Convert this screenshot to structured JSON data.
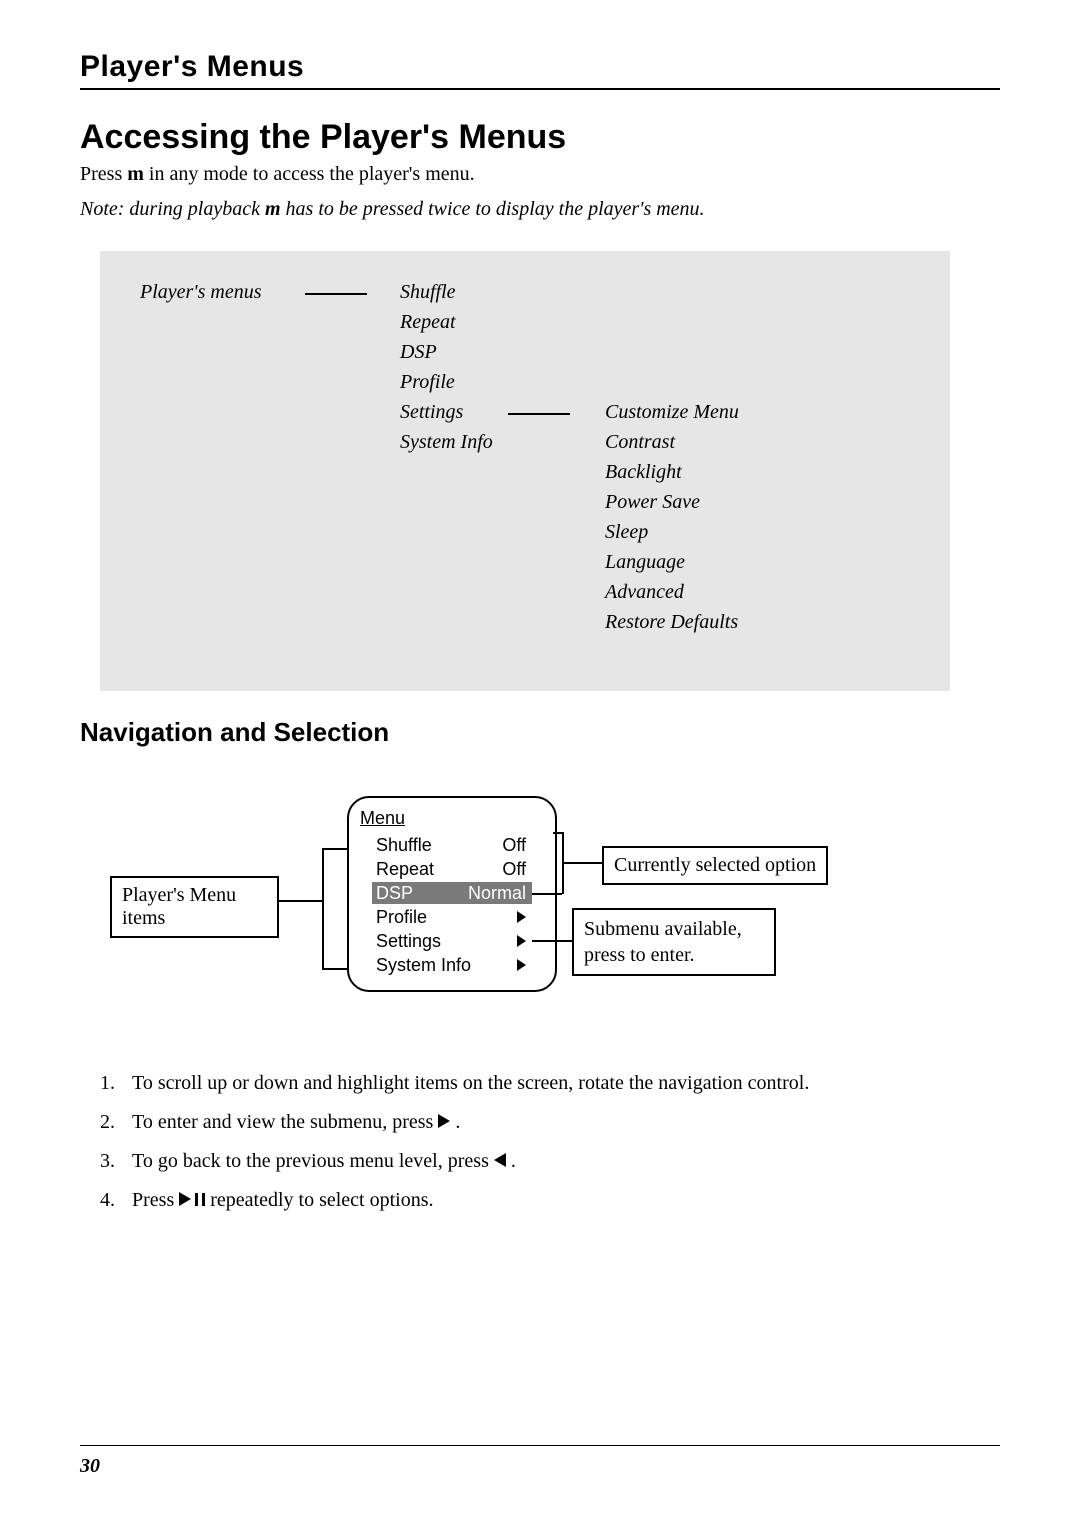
{
  "header": {
    "title": "Player's Menus"
  },
  "sectionTitle": "Accessing the Player's Menus",
  "intro": {
    "pre": "Press ",
    "key": "m",
    "post": " in any mode to access the player's menu."
  },
  "note": {
    "pre": "Note: during playback ",
    "key": "m",
    "post": " has to be pressed twice to display the player's menu."
  },
  "menuDiagram": {
    "rootLabel": "Player's menus",
    "topMenu": [
      "Shuffle",
      "Repeat",
      "DSP",
      "Profile",
      "Settings",
      "System Info"
    ],
    "settingsSubmenu": [
      "Customize Menu",
      "Contrast",
      "Backlight",
      "Power Save",
      "Sleep",
      "Language",
      "Advanced",
      "Restore Defaults"
    ]
  },
  "navSection": {
    "heading": "Navigation and Selection",
    "labelLeft": "Player's Menu items",
    "deviceMenuTitle": "Menu",
    "deviceRows": [
      {
        "name": "Shuffle",
        "value": "Off",
        "hasSub": false
      },
      {
        "name": "Repeat",
        "value": "Off",
        "hasSub": false
      },
      {
        "name": "DSP",
        "value": "Normal",
        "hasSub": false,
        "selected": true
      },
      {
        "name": "Profile",
        "value": "",
        "hasSub": true
      },
      {
        "name": "Settings",
        "value": "",
        "hasSub": true
      },
      {
        "name": "System Info",
        "value": "",
        "hasSub": true
      }
    ],
    "labelSelected": "Currently selected option",
    "labelSubmenu": "Submenu available, press to enter."
  },
  "instructions": {
    "i1": "To scroll up or down and highlight items on the screen, rotate the navigation control.",
    "i2pre": "To enter and view the submenu, press ",
    "i2post": " .",
    "i3pre": "To go back to the previous menu level, press ",
    "i3post": " .",
    "i4pre": "Press ",
    "i4post": " repeatedly to select options."
  },
  "pageNumber": "30"
}
